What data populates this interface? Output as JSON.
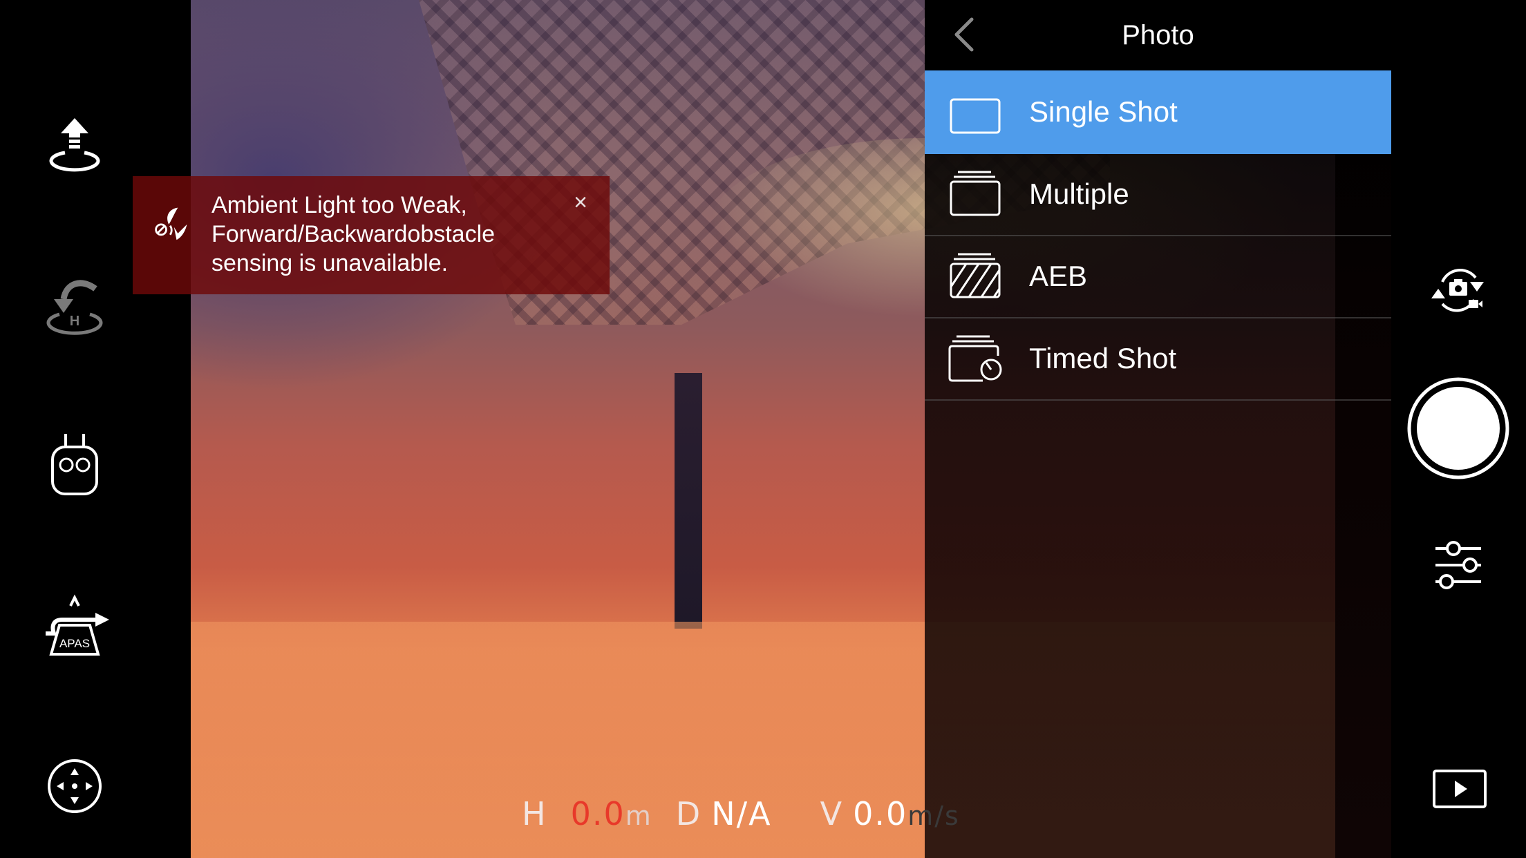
{
  "left_rail": {
    "items": [
      {
        "name": "takeoff",
        "icon": "takeoff-icon",
        "enabled": true
      },
      {
        "name": "return-to-home",
        "icon": "return-home-icon",
        "enabled": false
      },
      {
        "name": "remote-controller",
        "icon": "remote-controller-icon",
        "enabled": true
      },
      {
        "name": "apas",
        "icon": "apas-icon",
        "label": "APAS",
        "enabled": true
      },
      {
        "name": "intelligent-flight",
        "icon": "joystick-dpad-icon",
        "enabled": true
      }
    ]
  },
  "alert": {
    "icon": "obstacle-sensing-disabled-icon",
    "lines": [
      "Ambient Light too Weak,",
      "Forward/Backwardobstacle",
      "sensing is unavailable."
    ],
    "close_label": "×",
    "color": "#6e0808"
  },
  "photo_menu": {
    "title": "Photo",
    "back_icon": "chevron-left-icon",
    "selected_index": 0,
    "accent": "#4f9ceb",
    "items": [
      {
        "label": "Single Shot",
        "icon": "single-shot-icon"
      },
      {
        "label": "Multiple",
        "icon": "multiple-shot-icon"
      },
      {
        "label": "AEB",
        "icon": "aeb-icon"
      },
      {
        "label": "Timed Shot",
        "icon": "timed-shot-icon"
      }
    ]
  },
  "right_rail": {
    "items": [
      {
        "name": "photo-video-switch",
        "icon": "camera-video-switch-icon"
      },
      {
        "name": "shutter",
        "icon": "shutter-button-icon"
      },
      {
        "name": "camera-settings",
        "icon": "sliders-icon"
      },
      {
        "name": "playback",
        "icon": "play-icon"
      }
    ]
  },
  "telemetry": {
    "height_label": "H",
    "height_value": "0.0",
    "height_unit": "m",
    "distance_label": "D",
    "distance_value": "N/A",
    "vspeed_label": "V",
    "vspeed_value": "0.0",
    "vspeed_unit": "m/s",
    "alert_color": "#e8392a"
  }
}
